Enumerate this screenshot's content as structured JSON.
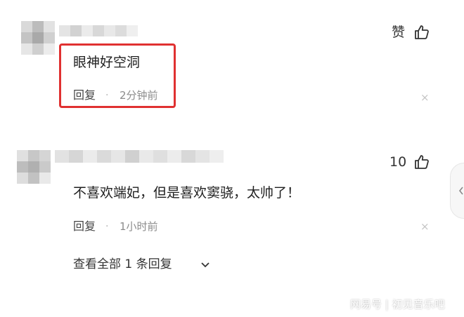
{
  "comments": [
    {
      "text": "眼神好空洞",
      "reply_label": "回复",
      "separator": "·",
      "time": "2分钟前",
      "like_label": "赞",
      "close_symbol": "×"
    },
    {
      "text": "不喜欢端妃，但是喜欢窦骁，太帅了！",
      "reply_label": "回复",
      "separator": "·",
      "time": "1小时前",
      "like_label": "10",
      "close_symbol": "×",
      "view_all_label": "查看全部 1 条回复"
    }
  ],
  "watermark": "网易号 | 初见音乐吧",
  "colors": {
    "highlight_border": "#e03131",
    "text": "#1f1f1f",
    "muted": "#8c8c8c"
  },
  "icons": [
    "thumbs-up-icon",
    "close-icon",
    "chevron-down-icon",
    "chevron-left-icon"
  ]
}
